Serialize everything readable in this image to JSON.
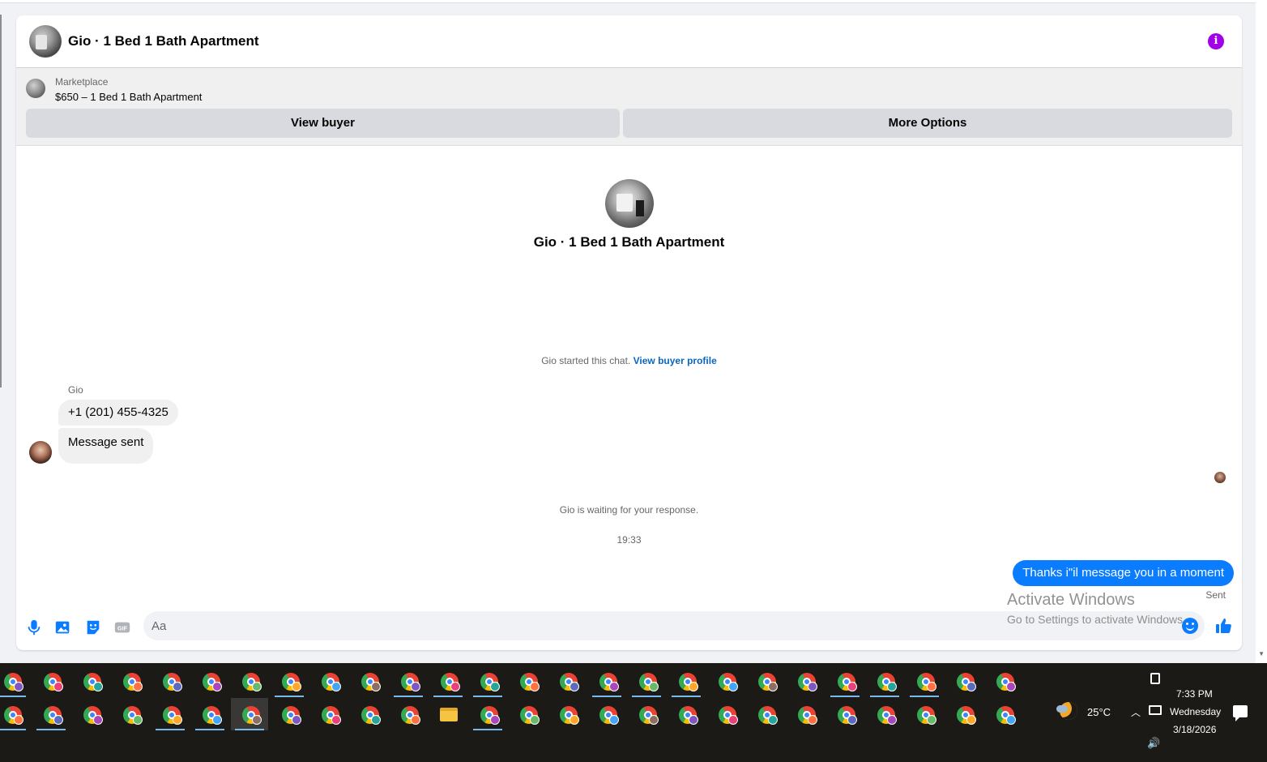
{
  "header": {
    "title": "Gio · 1 Bed 1 Bath Apartment",
    "info_icon": "info-icon"
  },
  "marketplace": {
    "label": "Marketplace",
    "listing": "$650 – 1 Bed 1 Bath Apartment",
    "view_buyer_label": "View buyer",
    "more_options_label": "More Options"
  },
  "intro": {
    "title": "Gio · 1 Bed 1 Bath Apartment",
    "started_text": "Gio started this chat.",
    "buyer_profile_link": "View buyer profile"
  },
  "messages": {
    "sender_name": "Gio",
    "incoming": [
      "+1 (201) 455-4325",
      "Message sent"
    ],
    "waiting_text": "Gio is waiting for your response.",
    "timestamp": "19:33",
    "outgoing": "Thanks i\"il message you in a moment",
    "status": "Sent"
  },
  "composer": {
    "placeholder": "Aa",
    "icons": [
      "microphone-icon",
      "photo-icon",
      "sticker-icon",
      "gif-icon",
      "emoji-icon",
      "thumbs-up-icon"
    ],
    "accent_color": "#0a7cff"
  },
  "watermark": {
    "line1": "Activate Windows",
    "line2": "Go to Settings to activate Windows."
  },
  "taskbar": {
    "weather_temp": "25°C",
    "time": "7:33 PM",
    "day": "Wednesday",
    "date": "3/18/2026",
    "background": "#1c1a17"
  }
}
